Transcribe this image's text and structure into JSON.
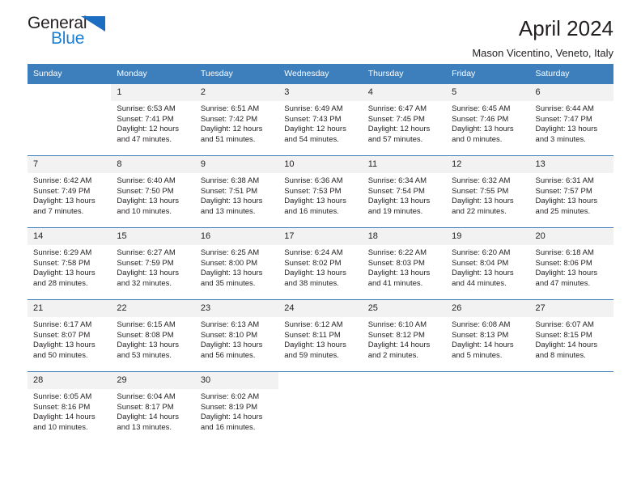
{
  "brand": {
    "name_part1": "General",
    "name_part2": "Blue",
    "triangle_color": "#1b6ec2",
    "blue_text_color": "#1b7fd4"
  },
  "header": {
    "title": "April 2024",
    "subtitle": "Mason Vicentino, Veneto, Italy"
  },
  "theme": {
    "header_row_bg": "#3d7ebd",
    "daynum_bg": "#f2f2f2",
    "text": "#231f20"
  },
  "weekdays": [
    "Sunday",
    "Monday",
    "Tuesday",
    "Wednesday",
    "Thursday",
    "Friday",
    "Saturday"
  ],
  "weeks": [
    [
      {
        "day": "",
        "sunrise": "",
        "sunset": "",
        "daylight": "",
        "empty": true
      },
      {
        "day": "1",
        "sunrise": "Sunrise: 6:53 AM",
        "sunset": "Sunset: 7:41 PM",
        "daylight": "Daylight: 12 hours and 47 minutes."
      },
      {
        "day": "2",
        "sunrise": "Sunrise: 6:51 AM",
        "sunset": "Sunset: 7:42 PM",
        "daylight": "Daylight: 12 hours and 51 minutes."
      },
      {
        "day": "3",
        "sunrise": "Sunrise: 6:49 AM",
        "sunset": "Sunset: 7:43 PM",
        "daylight": "Daylight: 12 hours and 54 minutes."
      },
      {
        "day": "4",
        "sunrise": "Sunrise: 6:47 AM",
        "sunset": "Sunset: 7:45 PM",
        "daylight": "Daylight: 12 hours and 57 minutes."
      },
      {
        "day": "5",
        "sunrise": "Sunrise: 6:45 AM",
        "sunset": "Sunset: 7:46 PM",
        "daylight": "Daylight: 13 hours and 0 minutes."
      },
      {
        "day": "6",
        "sunrise": "Sunrise: 6:44 AM",
        "sunset": "Sunset: 7:47 PM",
        "daylight": "Daylight: 13 hours and 3 minutes."
      }
    ],
    [
      {
        "day": "7",
        "sunrise": "Sunrise: 6:42 AM",
        "sunset": "Sunset: 7:49 PM",
        "daylight": "Daylight: 13 hours and 7 minutes."
      },
      {
        "day": "8",
        "sunrise": "Sunrise: 6:40 AM",
        "sunset": "Sunset: 7:50 PM",
        "daylight": "Daylight: 13 hours and 10 minutes."
      },
      {
        "day": "9",
        "sunrise": "Sunrise: 6:38 AM",
        "sunset": "Sunset: 7:51 PM",
        "daylight": "Daylight: 13 hours and 13 minutes."
      },
      {
        "day": "10",
        "sunrise": "Sunrise: 6:36 AM",
        "sunset": "Sunset: 7:53 PM",
        "daylight": "Daylight: 13 hours and 16 minutes."
      },
      {
        "day": "11",
        "sunrise": "Sunrise: 6:34 AM",
        "sunset": "Sunset: 7:54 PM",
        "daylight": "Daylight: 13 hours and 19 minutes."
      },
      {
        "day": "12",
        "sunrise": "Sunrise: 6:32 AM",
        "sunset": "Sunset: 7:55 PM",
        "daylight": "Daylight: 13 hours and 22 minutes."
      },
      {
        "day": "13",
        "sunrise": "Sunrise: 6:31 AM",
        "sunset": "Sunset: 7:57 PM",
        "daylight": "Daylight: 13 hours and 25 minutes."
      }
    ],
    [
      {
        "day": "14",
        "sunrise": "Sunrise: 6:29 AM",
        "sunset": "Sunset: 7:58 PM",
        "daylight": "Daylight: 13 hours and 28 minutes."
      },
      {
        "day": "15",
        "sunrise": "Sunrise: 6:27 AM",
        "sunset": "Sunset: 7:59 PM",
        "daylight": "Daylight: 13 hours and 32 minutes."
      },
      {
        "day": "16",
        "sunrise": "Sunrise: 6:25 AM",
        "sunset": "Sunset: 8:00 PM",
        "daylight": "Daylight: 13 hours and 35 minutes."
      },
      {
        "day": "17",
        "sunrise": "Sunrise: 6:24 AM",
        "sunset": "Sunset: 8:02 PM",
        "daylight": "Daylight: 13 hours and 38 minutes."
      },
      {
        "day": "18",
        "sunrise": "Sunrise: 6:22 AM",
        "sunset": "Sunset: 8:03 PM",
        "daylight": "Daylight: 13 hours and 41 minutes."
      },
      {
        "day": "19",
        "sunrise": "Sunrise: 6:20 AM",
        "sunset": "Sunset: 8:04 PM",
        "daylight": "Daylight: 13 hours and 44 minutes."
      },
      {
        "day": "20",
        "sunrise": "Sunrise: 6:18 AM",
        "sunset": "Sunset: 8:06 PM",
        "daylight": "Daylight: 13 hours and 47 minutes."
      }
    ],
    [
      {
        "day": "21",
        "sunrise": "Sunrise: 6:17 AM",
        "sunset": "Sunset: 8:07 PM",
        "daylight": "Daylight: 13 hours and 50 minutes."
      },
      {
        "day": "22",
        "sunrise": "Sunrise: 6:15 AM",
        "sunset": "Sunset: 8:08 PM",
        "daylight": "Daylight: 13 hours and 53 minutes."
      },
      {
        "day": "23",
        "sunrise": "Sunrise: 6:13 AM",
        "sunset": "Sunset: 8:10 PM",
        "daylight": "Daylight: 13 hours and 56 minutes."
      },
      {
        "day": "24",
        "sunrise": "Sunrise: 6:12 AM",
        "sunset": "Sunset: 8:11 PM",
        "daylight": "Daylight: 13 hours and 59 minutes."
      },
      {
        "day": "25",
        "sunrise": "Sunrise: 6:10 AM",
        "sunset": "Sunset: 8:12 PM",
        "daylight": "Daylight: 14 hours and 2 minutes."
      },
      {
        "day": "26",
        "sunrise": "Sunrise: 6:08 AM",
        "sunset": "Sunset: 8:13 PM",
        "daylight": "Daylight: 14 hours and 5 minutes."
      },
      {
        "day": "27",
        "sunrise": "Sunrise: 6:07 AM",
        "sunset": "Sunset: 8:15 PM",
        "daylight": "Daylight: 14 hours and 8 minutes."
      }
    ],
    [
      {
        "day": "28",
        "sunrise": "Sunrise: 6:05 AM",
        "sunset": "Sunset: 8:16 PM",
        "daylight": "Daylight: 14 hours and 10 minutes."
      },
      {
        "day": "29",
        "sunrise": "Sunrise: 6:04 AM",
        "sunset": "Sunset: 8:17 PM",
        "daylight": "Daylight: 14 hours and 13 minutes."
      },
      {
        "day": "30",
        "sunrise": "Sunrise: 6:02 AM",
        "sunset": "Sunset: 8:19 PM",
        "daylight": "Daylight: 14 hours and 16 minutes."
      },
      {
        "day": "",
        "sunrise": "",
        "sunset": "",
        "daylight": "",
        "empty": true
      },
      {
        "day": "",
        "sunrise": "",
        "sunset": "",
        "daylight": "",
        "empty": true
      },
      {
        "day": "",
        "sunrise": "",
        "sunset": "",
        "daylight": "",
        "empty": true
      },
      {
        "day": "",
        "sunrise": "",
        "sunset": "",
        "daylight": "",
        "empty": true
      }
    ]
  ]
}
